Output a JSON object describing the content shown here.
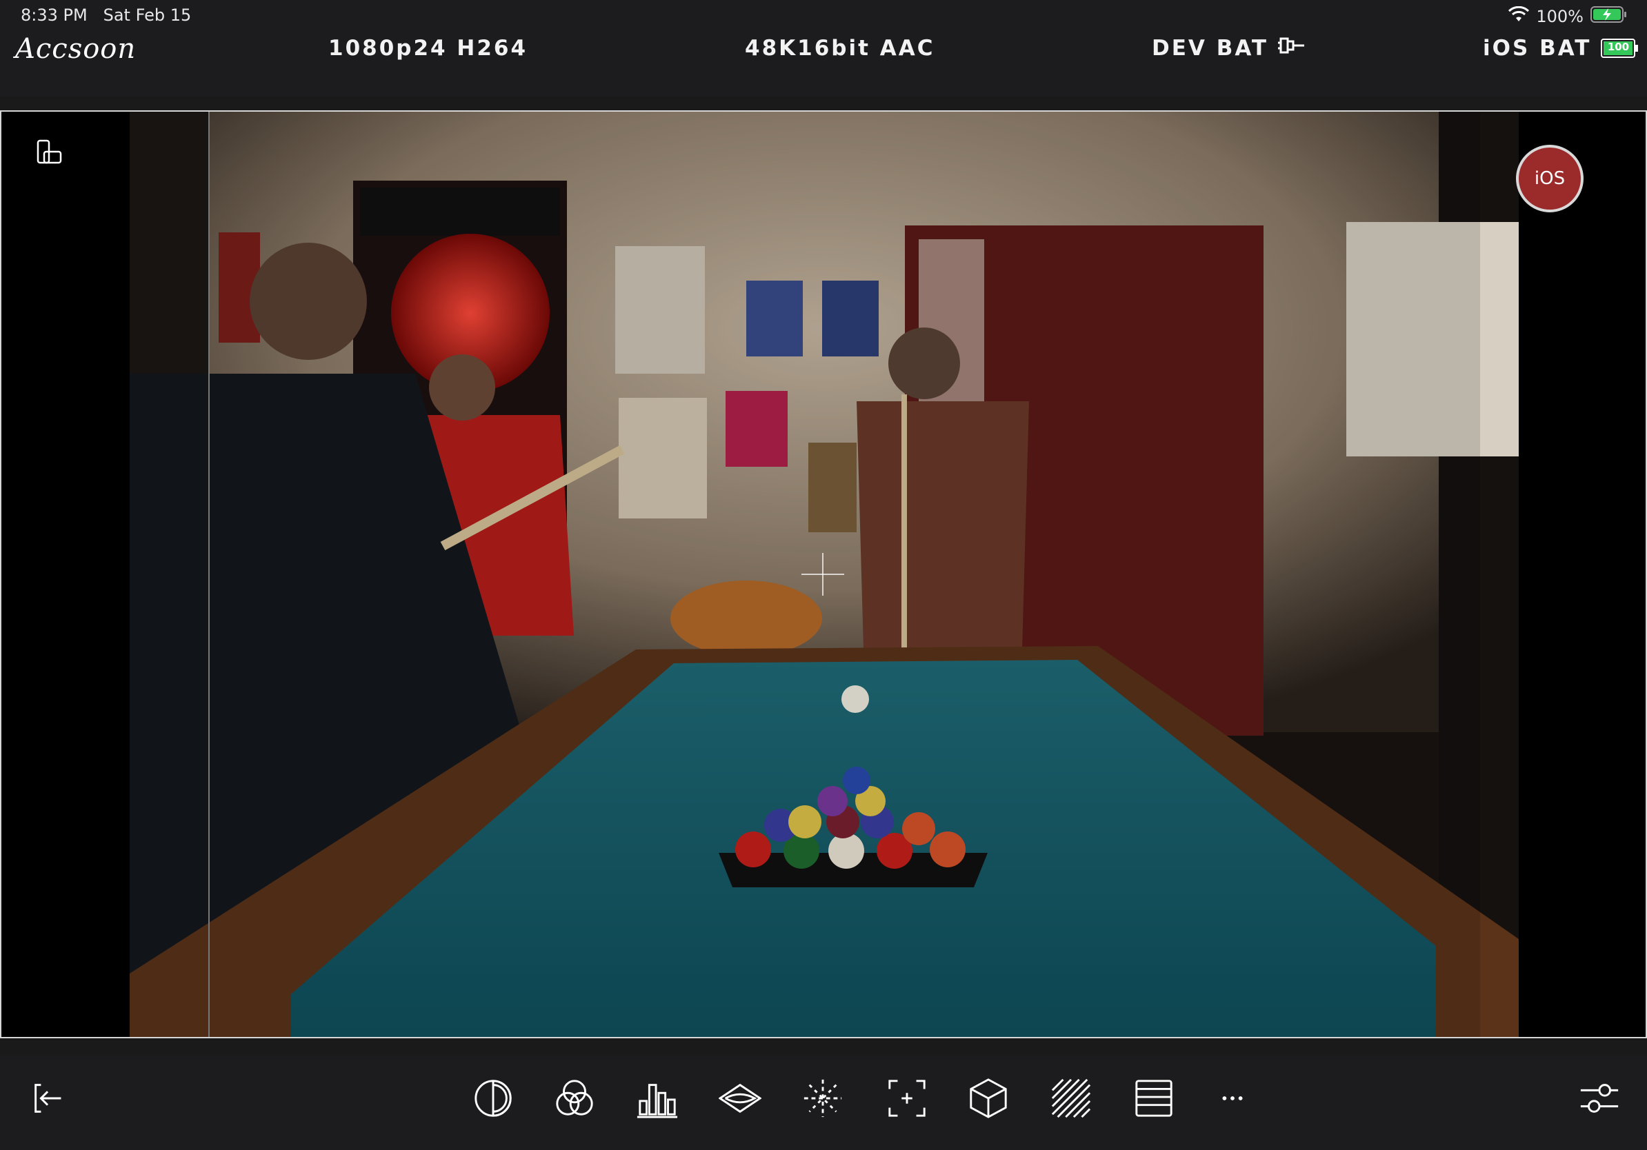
{
  "status_bar": {
    "time": "8:33 PM",
    "date": "Sat Feb 15",
    "battery_percent": "100%"
  },
  "header": {
    "logo": "Accsoon",
    "video_format": "1080p24 H264",
    "audio_format": "48K16bit AAC",
    "dev_bat_label": "DEV BAT",
    "ios_bat_label": "iOS BAT",
    "ios_bat_value": "100"
  },
  "viewer": {
    "record_label": "iOS",
    "icons": [
      "rotate-device-icon",
      "crosshair-icon"
    ]
  },
  "toolbar": {
    "tools": [
      "exit-icon",
      "false-color-icon",
      "color-channels-icon",
      "histogram-icon",
      "waveform-icon",
      "focus-peaking-icon",
      "center-marker-icon",
      "lut-cube-icon",
      "zebra-icon",
      "frame-guides-icon",
      "more-icon",
      "settings-sliders-icon"
    ]
  },
  "colors": {
    "bar_bg": "#1c1c1e",
    "record_red": "#9b2a2a",
    "battery_green": "#34c759"
  }
}
